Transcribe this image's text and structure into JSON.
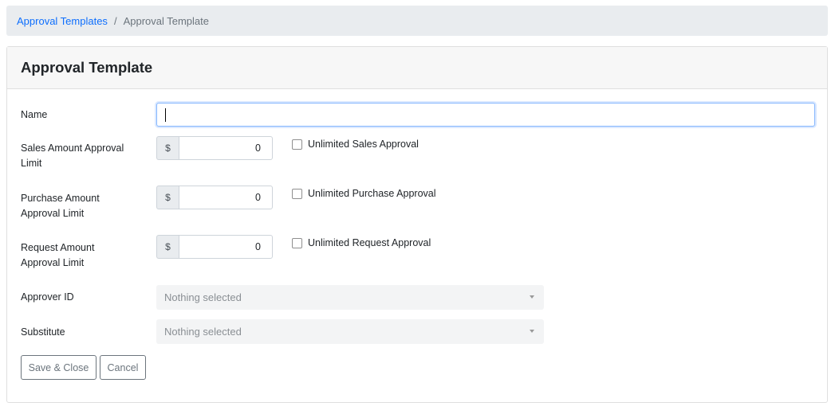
{
  "breadcrumb": {
    "parent": "Approval Templates",
    "separator": "/",
    "current": "Approval Template"
  },
  "card": {
    "title": "Approval Template"
  },
  "form": {
    "name": {
      "label": "Name",
      "value": ""
    },
    "sales": {
      "label_line1": "Sales Amount Approval",
      "label_line2": "Limit",
      "currency": "$",
      "value": "0",
      "checkbox_label": "Unlimited Sales Approval",
      "checked": false
    },
    "purchase": {
      "label_line1": "Purchase Amount",
      "label_line2": "Approval Limit",
      "currency": "$",
      "value": "0",
      "checkbox_label": "Unlimited Purchase Approval",
      "checked": false
    },
    "request": {
      "label_line1": "Request Amount",
      "label_line2": "Approval Limit",
      "currency": "$",
      "value": "0",
      "checkbox_label": "Unlimited Request Approval",
      "checked": false
    },
    "approver": {
      "label": "Approver ID",
      "placeholder": "Nothing selected"
    },
    "substitute": {
      "label": "Substitute",
      "placeholder": "Nothing selected"
    }
  },
  "buttons": {
    "save": "Save & Close",
    "cancel": "Cancel"
  },
  "colors": {
    "link": "#0d6efd",
    "focus_border": "#86b7fe",
    "breadcrumb_bg": "#e9ecef"
  }
}
